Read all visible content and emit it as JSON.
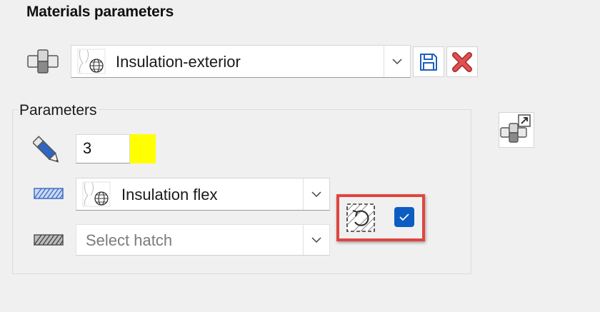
{
  "title": "Materials parameters",
  "material": {
    "selected": "Insulation-exterior"
  },
  "parameters": {
    "group_label": "Parameters",
    "pen_value": "3",
    "pen_color": "#ffff00",
    "hatch_primary": "Insulation flex",
    "hatch_secondary_placeholder": "Select hatch",
    "rotate_checked": true
  },
  "colors": {
    "highlight_border": "#e0453f",
    "checkbox_bg": "#0d5cc2",
    "save_icon": "#1d5fbf",
    "delete_icon": "#e05050",
    "hatch_blue": "#3a6fc7"
  },
  "icons": {
    "material": "material-blocks-icon",
    "save": "save-icon",
    "delete": "delete-x-icon",
    "pen": "pencil-icon",
    "hatch_blue": "hatch-pattern-icon",
    "hatch_gray": "hatch-pattern-gray-icon",
    "rotate": "rotate-hatch-icon",
    "check": "check-icon",
    "open_material": "material-shortcut-icon",
    "dropdown": "chevron-down-icon"
  }
}
